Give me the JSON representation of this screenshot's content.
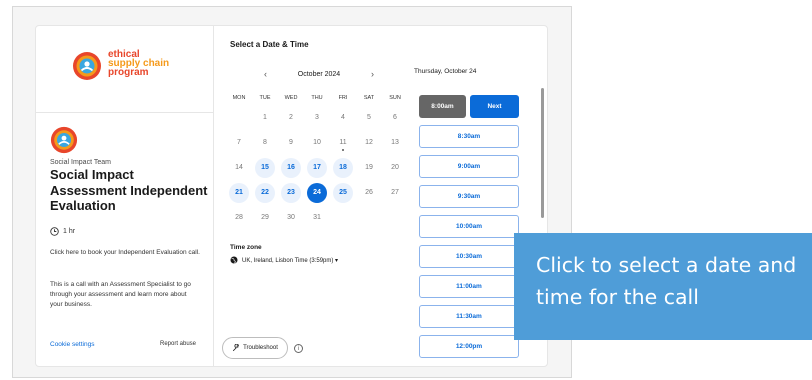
{
  "brand": {
    "logo_line1": "ethical",
    "logo_line2": "supply chain",
    "logo_line3": "program"
  },
  "event": {
    "team": "Social Impact Team",
    "title": "Social Impact Assessment Independent Evaluation",
    "duration": "1 hr",
    "description1": "Click here to book your Independent Evaluation call.",
    "description2": "This is a call with an Assessment Specialist to go through your assessment and learn more about your business."
  },
  "footer": {
    "cookie_settings": "Cookie settings",
    "report_abuse": "Report abuse",
    "troubleshoot": "Troubleshoot"
  },
  "scheduler": {
    "title": "Select a Date & Time",
    "month": "October 2024",
    "prev_icon": "‹",
    "next_icon": "›",
    "weekdays": [
      "MON",
      "TUE",
      "WED",
      "THU",
      "FRI",
      "SAT",
      "SUN"
    ],
    "days": [
      {
        "label": "1",
        "state": "normal"
      },
      {
        "label": "2",
        "state": "normal"
      },
      {
        "label": "3",
        "state": "normal"
      },
      {
        "label": "4",
        "state": "normal"
      },
      {
        "label": "5",
        "state": "normal"
      },
      {
        "label": "6",
        "state": "normal"
      },
      {
        "label": "7",
        "state": "normal"
      },
      {
        "label": "8",
        "state": "normal"
      },
      {
        "label": "9",
        "state": "normal"
      },
      {
        "label": "10",
        "state": "normal"
      },
      {
        "label": "11",
        "state": "today"
      },
      {
        "label": "12",
        "state": "normal"
      },
      {
        "label": "13",
        "state": "normal"
      },
      {
        "label": "14",
        "state": "normal"
      },
      {
        "label": "15",
        "state": "available"
      },
      {
        "label": "16",
        "state": "available"
      },
      {
        "label": "17",
        "state": "available"
      },
      {
        "label": "18",
        "state": "available"
      },
      {
        "label": "19",
        "state": "normal"
      },
      {
        "label": "20",
        "state": "normal"
      },
      {
        "label": "21",
        "state": "available"
      },
      {
        "label": "22",
        "state": "available"
      },
      {
        "label": "23",
        "state": "available"
      },
      {
        "label": "24",
        "state": "selected"
      },
      {
        "label": "25",
        "state": "available"
      },
      {
        "label": "26",
        "state": "normal"
      },
      {
        "label": "27",
        "state": "normal"
      },
      {
        "label": "28",
        "state": "normal"
      },
      {
        "label": "29",
        "state": "normal"
      },
      {
        "label": "30",
        "state": "normal"
      },
      {
        "label": "31",
        "state": "normal"
      }
    ],
    "timezone_label": "Time zone",
    "timezone_value": "UK, Ireland, Lisbon Time (3:59pm) ▾",
    "selected_date": "Thursday, October 24",
    "selected_slot": "8:00am",
    "next_label": "Next",
    "slots": [
      "8:30am",
      "9:00am",
      "9:30am",
      "10:00am",
      "10:30am",
      "11:00am",
      "11:30am",
      "12:00pm"
    ]
  },
  "tooltip": {
    "text": "Click to select a date and time for the call"
  },
  "colors": {
    "accent": "#0b6bd8",
    "tooltip_bg": "#4f9dd8",
    "logo_red": "#e8462b",
    "logo_orange": "#f59a1b"
  }
}
